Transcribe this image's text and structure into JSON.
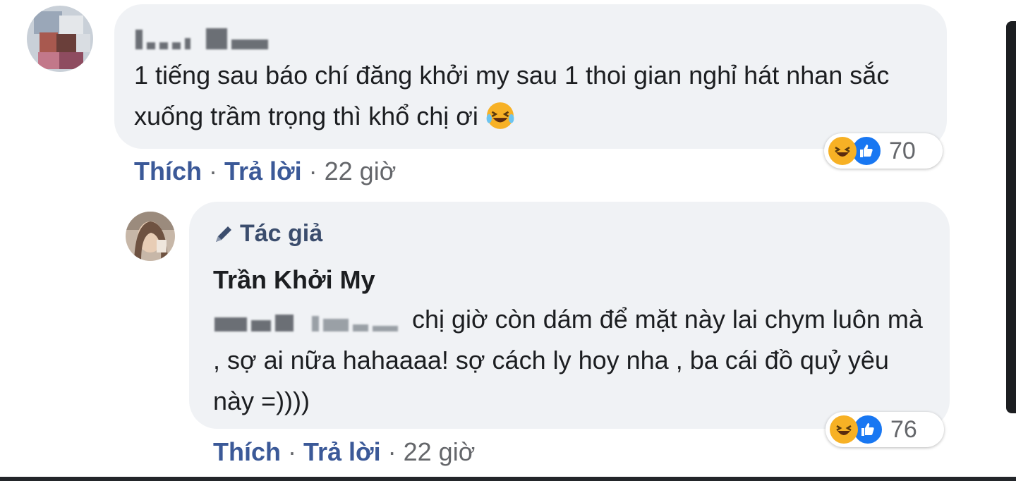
{
  "comment_1": {
    "text": "1 tiếng sau báo chí đăng khởi my sau 1 thoi gian nghỉ hát nhan sắc xuống trầm trọng thì khổ chị ơi",
    "emoji_icon": "laughing-tears-emoji",
    "reactions": {
      "icons": [
        "haha-reaction-icon",
        "like-reaction-icon"
      ],
      "count": "70"
    },
    "actions": {
      "like": "Thích",
      "reply": "Trả lời",
      "time": "22 giờ"
    }
  },
  "reply_1": {
    "badge": "Tác giả",
    "badge_icon": "pencil-icon",
    "author": "Trần Khởi My",
    "text": "chị giờ còn dám để mặt này lai chym luôn mà , sợ ai nữa hahaaaa! sợ cách ly hoy nha , ba cái đồ quỷ yêu này =))))",
    "reactions": {
      "icons": [
        "haha-reaction-icon",
        "like-reaction-icon"
      ],
      "count": "76"
    },
    "actions": {
      "like": "Thích",
      "reply": "Trả lời",
      "time": "22 giờ"
    }
  },
  "colors": {
    "bubble": "#f0f2f5",
    "link": "#3b5998",
    "meta": "#65676b",
    "haha": "#f7b125",
    "like": "#1877f2"
  }
}
